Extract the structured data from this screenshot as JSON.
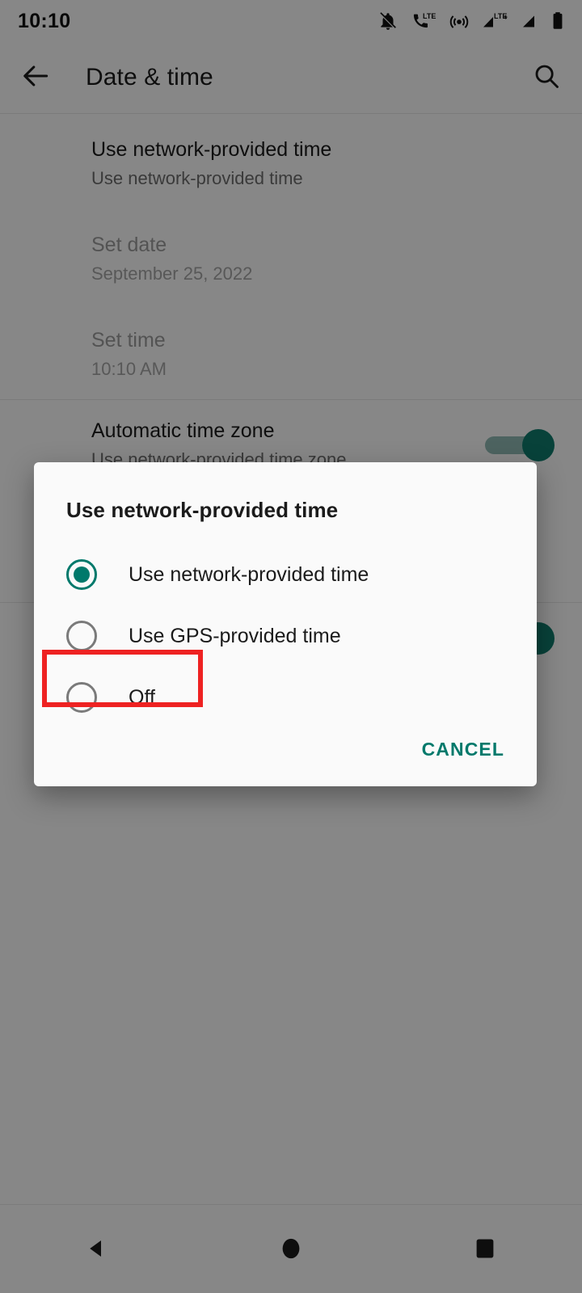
{
  "statusbar": {
    "clock": "10:10",
    "icons": [
      {
        "name": "notifications-off-icon",
        "glyph": "bell-muted"
      },
      {
        "name": "call-lte-icon",
        "glyph": "phone-lte"
      },
      {
        "name": "hotspot-icon",
        "glyph": "hotspot"
      },
      {
        "name": "signal-lte-icon",
        "glyph": "signal-lte"
      },
      {
        "name": "signal-secondary-icon",
        "glyph": "signal"
      },
      {
        "name": "battery-icon",
        "glyph": "battery"
      }
    ]
  },
  "appbar": {
    "back_icon": "arrow-back-icon",
    "title": "Date & time",
    "search_icon": "search-icon"
  },
  "settings_list": [
    {
      "title": "Use network-provided time",
      "subtitle": "Use network-provided time",
      "disabled": false,
      "switch": null
    },
    {
      "title": "Set date",
      "subtitle": "September 25, 2022",
      "disabled": true,
      "switch": null
    },
    {
      "title": "Set time",
      "subtitle": "10:10 AM",
      "disabled": true,
      "switch": null
    },
    {
      "title": "Automatic time zone",
      "subtitle": "Use network-provided time zone",
      "disabled": false,
      "switch": "on"
    }
  ],
  "dialog": {
    "title": "Use network-provided time",
    "options": [
      {
        "label": "Use network-provided time",
        "selected": true
      },
      {
        "label": "Use GPS-provided time",
        "selected": false
      },
      {
        "label": "Off",
        "selected": false
      }
    ],
    "cancel_label": "CANCEL"
  },
  "annotation": {
    "target": "Off",
    "color": "#ee2222"
  },
  "navbar": {
    "back": "nav-back-icon",
    "home": "nav-home-icon",
    "recents": "nav-recents-icon"
  },
  "colors": {
    "accent": "#00796b",
    "scrim": "rgba(0,0,0,0.46)",
    "surface": "#fafafa",
    "highlight": "#ee2222"
  }
}
